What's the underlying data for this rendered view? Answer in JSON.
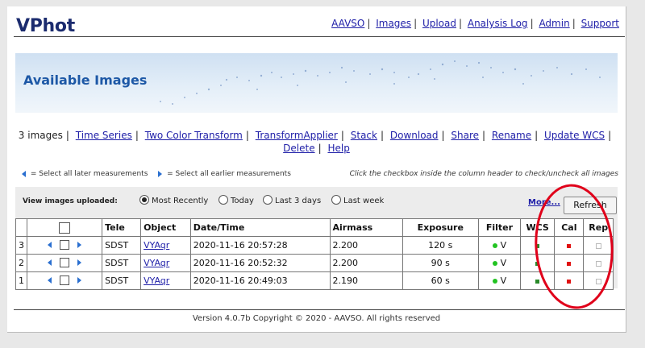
{
  "app": {
    "title": "VPhot"
  },
  "nav": [
    "AAVSO",
    "Images",
    "Upload",
    "Analysis Log",
    "Admin",
    "Support"
  ],
  "banner": {
    "title": "Available Images"
  },
  "actions": {
    "count_text": "3 images",
    "links": [
      "Time Series",
      "Two Color Transform",
      "TransformApplier",
      "Stack",
      "Download",
      "Share",
      "Rename",
      "Update WCS",
      "Delete",
      "Help"
    ]
  },
  "hints": {
    "later": "= Select all later measurements",
    "earlier": "= Select all earlier measurements",
    "checkbox_hint": "Click the checkbox inside the column header to check/uncheck all images"
  },
  "view": {
    "label": "View images uploaded:",
    "options": [
      "Most Recently",
      "Today",
      "Last 3 days",
      "Last week"
    ],
    "selected_index": 0,
    "more_label": "More...",
    "refresh_label": "Refresh"
  },
  "table": {
    "headers": [
      "",
      "",
      "Tele",
      "Object",
      "Date/Time",
      "Airmass",
      "Exposure",
      "Filter",
      "WCS",
      "Cal",
      "Rep"
    ],
    "rows": [
      {
        "num": "3",
        "tele": "SDST",
        "object": "VYAqr",
        "datetime": "2020-11-16 20:57:28",
        "airmass": "2.200",
        "exposure": "120 s",
        "filter": "V",
        "wcs_color": "#2a8a2a",
        "cal_color": "#e01010"
      },
      {
        "num": "2",
        "tele": "SDST",
        "object": "VYAqr",
        "datetime": "2020-11-16 20:52:32",
        "airmass": "2.200",
        "exposure": "90 s",
        "filter": "V",
        "wcs_color": "#2a8a2a",
        "cal_color": "#e01010"
      },
      {
        "num": "1",
        "tele": "SDST",
        "object": "VYAqr",
        "datetime": "2020-11-16 20:49:03",
        "airmass": "2.190",
        "exposure": "60 s",
        "filter": "V",
        "wcs_color": "#2a8a2a",
        "cal_color": "#e01010"
      }
    ]
  },
  "footer": {
    "text": "Version 4.0.7b Copyright © 2020 - AAVSO. All rights reserved"
  },
  "colors": {
    "link": "#1f1fa8",
    "title": "#1b2b6e",
    "banner_title": "#1d58a6",
    "annotation": "#e0001a"
  }
}
